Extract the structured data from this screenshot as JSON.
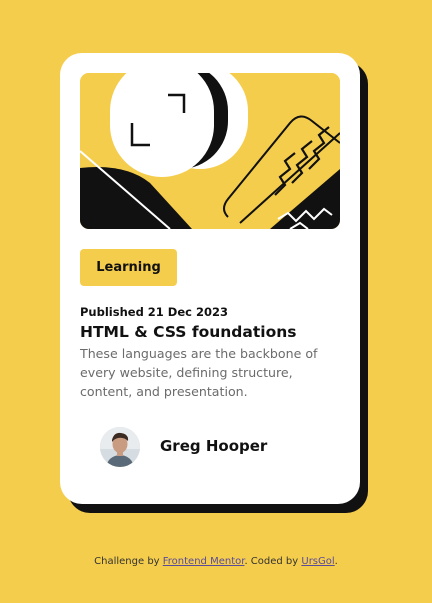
{
  "card": {
    "badge_label": "Learning",
    "published": "Published 21 Dec 2023",
    "title": "HTML & CSS foundations",
    "description": "These languages are the backbone of every website, defining structure, content, and presentation.",
    "author_name": "Greg Hooper"
  },
  "footer": {
    "prefix": "Challenge by ",
    "challenge_link": "Frontend Mentor",
    "middle": ". Coded by ",
    "author_link": "UrsGol",
    "suffix": "."
  },
  "colors": {
    "background": "#f5cd4c",
    "card": "#ffffff",
    "ink": "#111111",
    "muted": "#6b6b6b",
    "link": "#5a4a9a"
  },
  "icons": {
    "hero": "abstract-illustration",
    "avatar": "user-avatar"
  }
}
